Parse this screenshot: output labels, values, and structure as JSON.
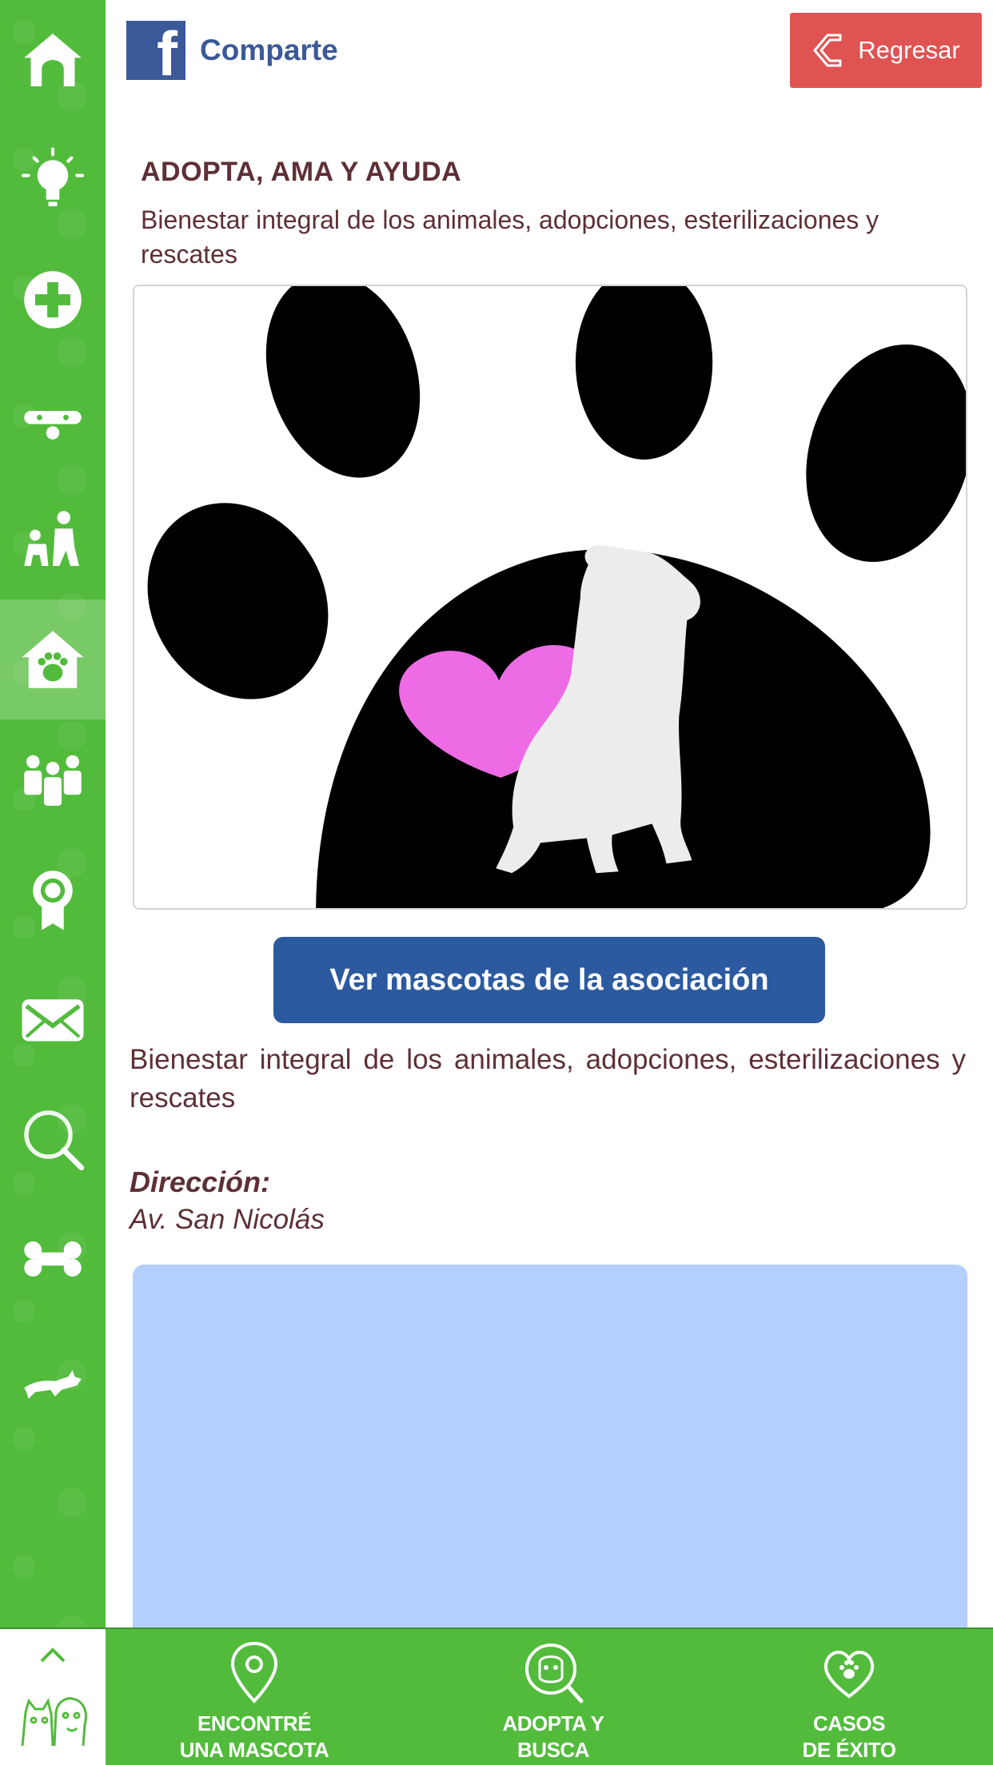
{
  "header": {
    "share_label": "Comparte",
    "back_label": "Regresar"
  },
  "sidebar": {
    "items": [
      {
        "icon": "house-icon"
      },
      {
        "icon": "lightbulb-icon"
      },
      {
        "icon": "plus-icon"
      },
      {
        "icon": "dog-collar-icon"
      },
      {
        "icon": "person-with-pet-icon"
      },
      {
        "icon": "doghouse-paw-icon",
        "active": true
      },
      {
        "icon": "people-group-icon"
      },
      {
        "icon": "award-ribbon-icon"
      },
      {
        "icon": "mail-icon"
      },
      {
        "icon": "search-icon"
      },
      {
        "icon": "bone-icon"
      },
      {
        "icon": "cat-icon"
      }
    ]
  },
  "association": {
    "title": "ADOPTA, AMA Y AYUDA",
    "subtitle": "Bienestar integral de los animales, adopciones, esterilizaciones y rescates",
    "pets_button": "Ver mascotas de la asociación",
    "description": "Bienestar integral de los animales, adopciones, esterilizaciones y rescates",
    "address_label": "Dirección:",
    "address_value": "Av. San Nicolás"
  },
  "bottom_nav": {
    "items": [
      {
        "label_line1": "ENCONTRÉ",
        "label_line2": "UNA MASCOTA",
        "icon": "location-pin-icon"
      },
      {
        "label_line1": "ADOPTA Y",
        "label_line2": "BUSCA",
        "icon": "dog-search-icon"
      },
      {
        "label_line1": "CASOS",
        "label_line2": "DE ÉXITO",
        "icon": "heart-paw-icon"
      }
    ]
  },
  "colors": {
    "green": "#52bb3c",
    "facebook_blue": "#3b5998",
    "back_red": "#e05353",
    "button_blue": "#2c5aa0",
    "text_maroon": "#5e2f36",
    "map_blue": "#b3cfff",
    "heart_pink": "#ee6be6"
  }
}
